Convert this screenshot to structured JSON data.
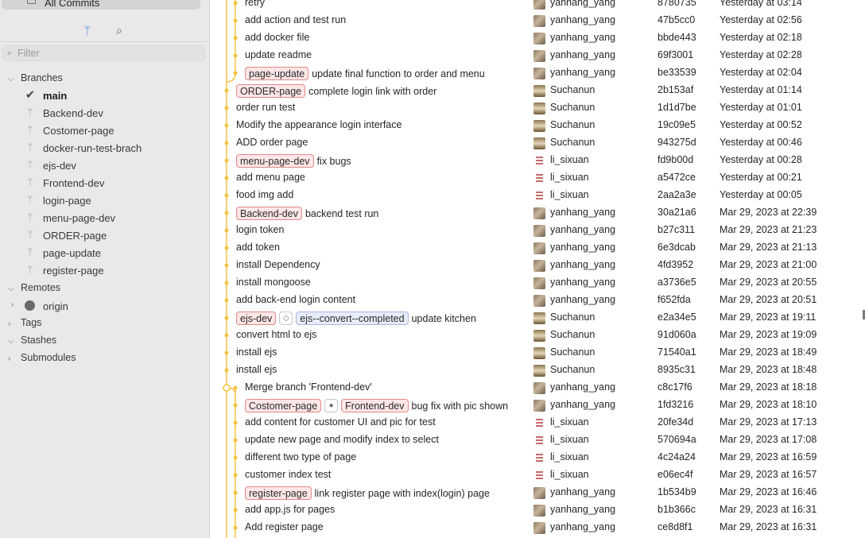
{
  "sidebar": {
    "all_commits_label": "All Commits",
    "filter_placeholder": "Filter",
    "sections": {
      "branches": "Branches",
      "remotes": "Remotes",
      "tags": "Tags",
      "stashes": "Stashes",
      "submodules": "Submodules"
    },
    "branches": [
      {
        "name": "main",
        "current": true
      },
      {
        "name": "Backend-dev"
      },
      {
        "name": "Costomer-page"
      },
      {
        "name": "docker-run-test-brach"
      },
      {
        "name": "ejs-dev"
      },
      {
        "name": "Frontend-dev"
      },
      {
        "name": "login-page"
      },
      {
        "name": "menu-page-dev"
      },
      {
        "name": "ORDER-page"
      },
      {
        "name": "page-update"
      },
      {
        "name": "register-page"
      }
    ],
    "remotes": [
      {
        "name": "origin"
      }
    ]
  },
  "colors": {
    "graph_line": "#f5c242",
    "tag_red_border": "#e08a8a",
    "tag_blue_border": "#a9b6e0"
  },
  "commits": [
    {
      "message": "retry",
      "author": "yanhang_yang",
      "sha": "8780735",
      "date": "Yesterday at 03:14",
      "indent": 1
    },
    {
      "message": "add action and test run",
      "author": "yanhang_yang",
      "sha": "47b5cc0",
      "date": "Yesterday at 02:56",
      "indent": 1
    },
    {
      "message": "add docker file",
      "author": "yanhang_yang",
      "sha": "bbde443",
      "date": "Yesterday at 02:18",
      "indent": 1
    },
    {
      "message": "update readme",
      "author": "yanhang_yang",
      "sha": "69f3001",
      "date": "Yesterday at 02:28",
      "indent": 1
    },
    {
      "message": "update final function to order and menu",
      "author": "yanhang_yang",
      "sha": "be33539",
      "date": "Yesterday at 02:04",
      "indent": 1,
      "refs": [
        "page-update"
      ]
    },
    {
      "message": "complete login link with order",
      "author": "Suchanun",
      "sha": "2b153af",
      "date": "Yesterday at 01:14",
      "indent": 0,
      "refs": [
        "ORDER-page"
      ]
    },
    {
      "message": "order run test",
      "author": "Suchanun",
      "sha": "1d1d7be",
      "date": "Yesterday at 01:01",
      "indent": 0
    },
    {
      "message": "Modify the appearance  login interface",
      "author": "Suchanun",
      "sha": "19c09e5",
      "date": "Yesterday at 00:52",
      "indent": 0
    },
    {
      "message": "ADD order page",
      "author": "Suchanun",
      "sha": "943275d",
      "date": "Yesterday at 00:46",
      "indent": 0
    },
    {
      "message": "fix bugs",
      "author": "li_sixuan",
      "sha": "fd9b00d",
      "date": "Yesterday at 00:28",
      "indent": 0,
      "refs": [
        "menu-page-dev"
      ]
    },
    {
      "message": "add menu page",
      "author": "li_sixuan",
      "sha": "a5472ce",
      "date": "Yesterday at 00:21",
      "indent": 0
    },
    {
      "message": "food img add",
      "author": "li_sixuan",
      "sha": "2aa2a3e",
      "date": "Yesterday at 00:05",
      "indent": 0
    },
    {
      "message": "backend test run",
      "author": "yanhang_yang",
      "sha": "30a21a6",
      "date": "Mar 29, 2023 at 22:39",
      "indent": 0,
      "refs": [
        "Backend-dev"
      ]
    },
    {
      "message": "login token",
      "author": "yanhang_yang",
      "sha": "b27c311",
      "date": "Mar 29, 2023 at 21:23",
      "indent": 0
    },
    {
      "message": "add token",
      "author": "yanhang_yang",
      "sha": "6e3dcab",
      "date": "Mar 29, 2023 at 21:13",
      "indent": 0
    },
    {
      "message": "install Dependency",
      "author": "yanhang_yang",
      "sha": "4fd3952",
      "date": "Mar 29, 2023 at 21:00",
      "indent": 0
    },
    {
      "message": "install mongoose",
      "author": "yanhang_yang",
      "sha": "a3736e5",
      "date": "Mar 29, 2023 at 20:55",
      "indent": 0
    },
    {
      "message": "add back-end login content",
      "author": "yanhang_yang",
      "sha": "f652fda",
      "date": "Mar 29, 2023 at 20:51",
      "indent": 0
    },
    {
      "message": "update kitchen",
      "author": "Suchanun",
      "sha": "e2a34e5",
      "date": "Mar 29, 2023 at 19:11",
      "indent": 0,
      "refs": [
        "ejs-dev"
      ],
      "tag_icon": "tag-icon",
      "tags": [
        "ejs--convert--completed"
      ]
    },
    {
      "message": "convert html to ejs",
      "author": "Suchanun",
      "sha": "91d060a",
      "date": "Mar 29, 2023 at 19:09",
      "indent": 0
    },
    {
      "message": "install ejs",
      "author": "Suchanun",
      "sha": "71540a1",
      "date": "Mar 29, 2023 at 18:49",
      "indent": 0
    },
    {
      "message": "install ejs",
      "author": "Suchanun",
      "sha": "8935c31",
      "date": "Mar 29, 2023 at 18:48",
      "indent": 0
    },
    {
      "message": "Merge branch 'Frontend-dev'",
      "author": "yanhang_yang",
      "sha": "c8c17f6",
      "date": "Mar 29, 2023 at 18:18",
      "indent": 1
    },
    {
      "message": "bug fix with pic shown",
      "author": "yanhang_yang",
      "sha": "1fd3216",
      "date": "Mar 29, 2023 at 18:10",
      "indent": 1,
      "refs": [
        "Costomer-page"
      ],
      "remote_icon": "github-icon",
      "refs2": [
        "Frontend-dev"
      ]
    },
    {
      "message": "add content for customer UI and pic for test",
      "author": "li_sixuan",
      "sha": "20fe34d",
      "date": "Mar 29, 2023 at 17:13",
      "indent": 1
    },
    {
      "message": "update new page and modify index to select",
      "author": "li_sixuan",
      "sha": "570694a",
      "date": "Mar 29, 2023 at 17:08",
      "indent": 1
    },
    {
      "message": "different two type of page",
      "author": "li_sixuan",
      "sha": "4c24a24",
      "date": "Mar 29, 2023 at 16:59",
      "indent": 1
    },
    {
      "message": "customer index test",
      "author": "li_sixuan",
      "sha": "e06ec4f",
      "date": "Mar 29, 2023 at 16:57",
      "indent": 1
    },
    {
      "message": "link register page with index(login) page",
      "author": "yanhang_yang",
      "sha": "1b534b9",
      "date": "Mar 29, 2023 at 16:46",
      "indent": 1,
      "refs": [
        "register-page"
      ]
    },
    {
      "message": "add app.js for pages",
      "author": "yanhang_yang",
      "sha": "b1b366c",
      "date": "Mar 29, 2023 at 16:31",
      "indent": 1
    },
    {
      "message": "Add register page",
      "author": "yanhang_yang",
      "sha": "ce8d8f1",
      "date": "Mar 29, 2023 at 16:31",
      "indent": 1
    }
  ]
}
